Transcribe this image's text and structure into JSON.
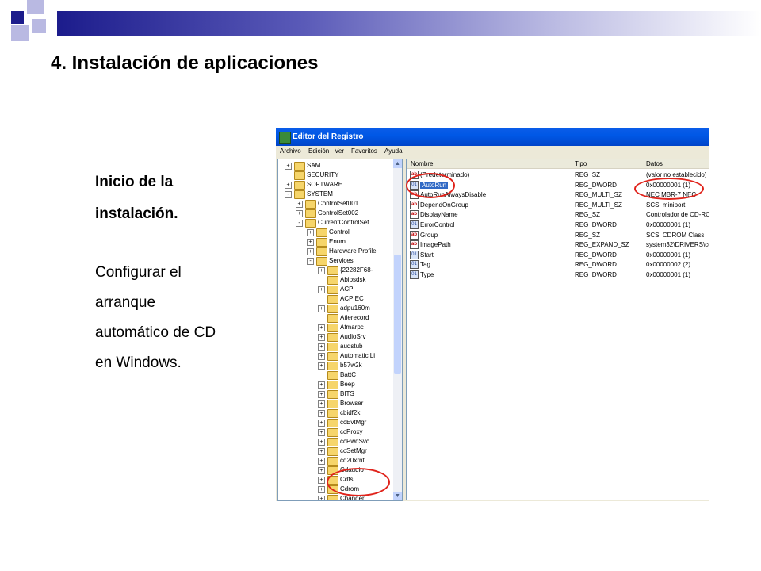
{
  "slide": {
    "title": "4. Instalación de aplicaciones",
    "subtitle_lines": [
      "Inicio de la",
      "instalación."
    ],
    "body_lines": [
      "Configurar el",
      "arranque",
      "automático de CD",
      "en Windows."
    ],
    "colors": {
      "dark_square": "#1c1c8c",
      "light_square": "#b9b9e2",
      "highlight": "#e0231b"
    }
  },
  "regedit": {
    "title": "Editor del Registro",
    "menu": [
      "Archivo",
      "Edición",
      "Ver",
      "Favoritos",
      "Ayuda"
    ],
    "tree": [
      {
        "label": "SAM",
        "expander": "+"
      },
      {
        "label": "SECURITY",
        "expander": ""
      },
      {
        "label": "SOFTWARE",
        "expander": "+"
      },
      {
        "label": "SYSTEM",
        "expander": "-"
      },
      {
        "label": "ControlSet001",
        "expander": "+"
      },
      {
        "label": "ControlSet002",
        "expander": "+"
      },
      {
        "label": "CurrentControlSet",
        "expander": "-"
      },
      {
        "label": "Control",
        "expander": "+"
      },
      {
        "label": "Enum",
        "expander": "+"
      },
      {
        "label": "Hardware Profile",
        "expander": "+"
      },
      {
        "label": "Services",
        "expander": "-"
      },
      {
        "label": "{22282F68-",
        "expander": "+"
      },
      {
        "label": "Abiosdsk",
        "expander": ""
      },
      {
        "label": "ACPI",
        "expander": "+"
      },
      {
        "label": "ACPIEC",
        "expander": ""
      },
      {
        "label": "adpu160m",
        "expander": "+"
      },
      {
        "label": "Atierecord",
        "expander": ""
      },
      {
        "label": "Atmarpc",
        "expander": "+"
      },
      {
        "label": "AudioSrv",
        "expander": "+"
      },
      {
        "label": "audstub",
        "expander": "+"
      },
      {
        "label": "Automatic Li",
        "expander": "+"
      },
      {
        "label": "b57w2k",
        "expander": "+"
      },
      {
        "label": "BattC",
        "expander": ""
      },
      {
        "label": "Beep",
        "expander": "+"
      },
      {
        "label": "BITS",
        "expander": "+"
      },
      {
        "label": "Browser",
        "expander": "+"
      },
      {
        "label": "cbidf2k",
        "expander": "+"
      },
      {
        "label": "ccEvtMgr",
        "expander": "+"
      },
      {
        "label": "ccProxy",
        "expander": "+"
      },
      {
        "label": "ccPwdSvc",
        "expander": "+"
      },
      {
        "label": "ccSetMgr",
        "expander": "+"
      },
      {
        "label": "cd20xrnt",
        "expander": "+"
      },
      {
        "label": "Cdaudio",
        "expander": "+"
      },
      {
        "label": "Cdfs",
        "expander": "+"
      },
      {
        "label": "Cdrom",
        "expander": "+"
      },
      {
        "label": "Changer",
        "expander": "+"
      }
    ],
    "columns": [
      "Nombre",
      "Tipo",
      "Datos"
    ],
    "values": [
      {
        "name": "(Predeterminado)",
        "type": "REG_SZ",
        "data": "(valor no establecido)",
        "icon": "ab"
      },
      {
        "name": "AutoRun",
        "type": "REG_DWORD",
        "data": "0x00000001 (1)",
        "icon": "dw"
      },
      {
        "name": "AutoRunAlwaysDisable",
        "type": "REG_MULTI_SZ",
        "data": "NEC   MBR-7   NEC",
        "icon": "ab"
      },
      {
        "name": "DependOnGroup",
        "type": "REG_MULTI_SZ",
        "data": "SCSI miniport",
        "icon": "ab"
      },
      {
        "name": "DisplayName",
        "type": "REG_SZ",
        "data": "Controlador de CD-ROM",
        "icon": "ab"
      },
      {
        "name": "ErrorControl",
        "type": "REG_DWORD",
        "data": "0x00000001 (1)",
        "icon": "dw"
      },
      {
        "name": "Group",
        "type": "REG_SZ",
        "data": "SCSI CDROM Class",
        "icon": "ab"
      },
      {
        "name": "ImagePath",
        "type": "REG_EXPAND_SZ",
        "data": "system32\\DRIVERS\\cdrom",
        "icon": "ab"
      },
      {
        "name": "Start",
        "type": "REG_DWORD",
        "data": "0x00000001 (1)",
        "icon": "dw"
      },
      {
        "name": "Tag",
        "type": "REG_DWORD",
        "data": "0x00000002 (2)",
        "icon": "dw"
      },
      {
        "name": "Type",
        "type": "REG_DWORD",
        "data": "0x00000001 (1)",
        "icon": "dw"
      }
    ]
  }
}
